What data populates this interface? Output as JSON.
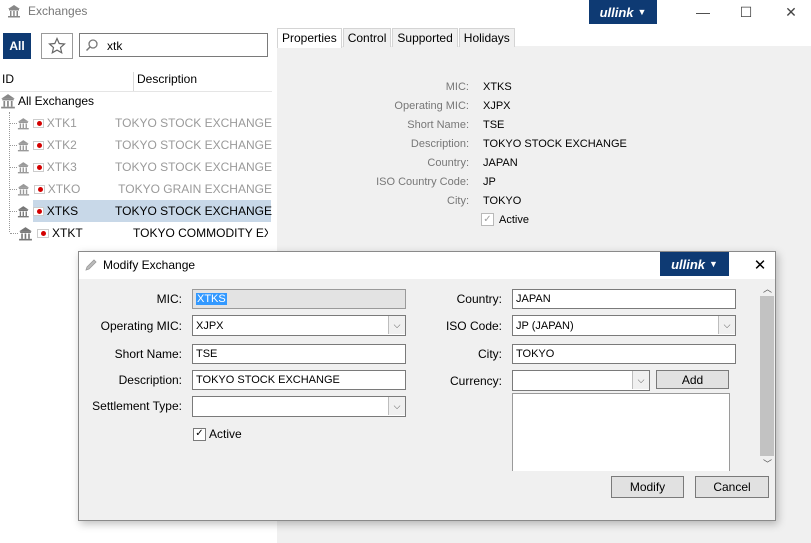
{
  "window": {
    "title": "Exchanges",
    "brand": "ullink",
    "minimize": "—",
    "maximize": "☐",
    "close": "✕"
  },
  "left": {
    "all_label": "All",
    "search_value": "xtk",
    "columns": [
      "ID",
      "Description"
    ],
    "root_label": "All Exchanges",
    "rows": [
      {
        "id": "XTK1",
        "desc": "TOKYO STOCK EXCHANGE",
        "enabled": false
      },
      {
        "id": "XTK2",
        "desc": "TOKYO STOCK EXCHANGE",
        "enabled": false
      },
      {
        "id": "XTK3",
        "desc": "TOKYO STOCK EXCHANGE",
        "enabled": false
      },
      {
        "id": "XTKO",
        "desc": "TOKYO GRAIN EXCHANGE",
        "enabled": false
      },
      {
        "id": "XTKS",
        "desc": "TOKYO STOCK EXCHANGE",
        "enabled": true,
        "selected": true
      },
      {
        "id": "XTKT",
        "desc": "TOKYO COMMODITY EXCH",
        "enabled": true
      }
    ]
  },
  "tabs": [
    "Properties",
    "Control",
    "Supported",
    "Holidays"
  ],
  "properties": [
    {
      "label": "MIC:",
      "value": "XTKS"
    },
    {
      "label": "Operating MIC:",
      "value": "XJPX"
    },
    {
      "label": "Short Name:",
      "value": "TSE"
    },
    {
      "label": "Description:",
      "value": "TOKYO STOCK EXCHANGE"
    },
    {
      "label": "Country:",
      "value": "JAPAN"
    },
    {
      "label": "ISO Country Code:",
      "value": "JP"
    },
    {
      "label": "City:",
      "value": "TOKYO"
    }
  ],
  "properties_active_label": "Active",
  "dialog": {
    "title": "Modify Exchange",
    "brand": "ullink",
    "close": "✕",
    "mic_label": "MIC:",
    "mic_value": "XTKS",
    "opmic_label": "Operating MIC:",
    "opmic_value": "XJPX",
    "shortname_label": "Short Name:",
    "shortname_value": "TSE",
    "description_label": "Description:",
    "description_value": "TOKYO STOCK EXCHANGE",
    "settlement_label": "Settlement Type:",
    "settlement_value": "",
    "active_label": "Active",
    "country_label": "Country:",
    "country_value": "JAPAN",
    "iso_label": "ISO Code:",
    "iso_value": "JP (JAPAN)",
    "city_label": "City:",
    "city_value": "TOKYO",
    "currency_label": "Currency:",
    "currency_value": "",
    "add_label": "Add",
    "modify_label": "Modify",
    "cancel_label": "Cancel"
  },
  "colors": {
    "brand_blue": "#0e3a73",
    "selection": "#c8d8e8"
  }
}
